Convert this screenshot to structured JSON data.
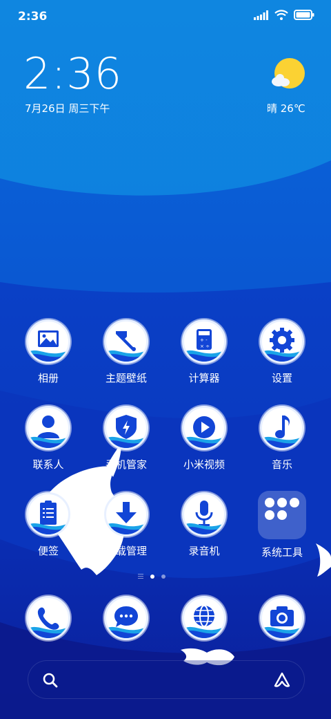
{
  "status_bar": {
    "time": "2:36",
    "icons": [
      "signal-icon",
      "wifi-icon",
      "battery-icon"
    ]
  },
  "clock_widget": {
    "time": "2:36",
    "date": "7月26日 周三下午"
  },
  "weather_widget": {
    "icon": "sunny-cloud-icon",
    "text": "晴 26℃"
  },
  "apps": [
    {
      "label": "相册",
      "icon": "gallery-icon"
    },
    {
      "label": "主题壁纸",
      "icon": "themes-brush-icon"
    },
    {
      "label": "计算器",
      "icon": "calculator-icon"
    },
    {
      "label": "设置",
      "icon": "settings-gear-icon"
    },
    {
      "label": "联系人",
      "icon": "contacts-person-icon"
    },
    {
      "label": "手机管家",
      "icon": "security-shield-icon"
    },
    {
      "label": "小米视频",
      "icon": "video-play-icon"
    },
    {
      "label": "音乐",
      "icon": "music-note-icon"
    },
    {
      "label": "便签",
      "icon": "notes-clipboard-icon"
    },
    {
      "label": "下载管理",
      "icon": "download-arrow-icon"
    },
    {
      "label": "录音机",
      "icon": "recorder-mic-icon"
    },
    {
      "label": "系统工具",
      "icon": "folder-icon"
    }
  ],
  "dock": [
    {
      "icon": "phone-icon"
    },
    {
      "icon": "messages-icon"
    },
    {
      "icon": "browser-globe-icon"
    },
    {
      "icon": "camera-icon"
    }
  ],
  "page_indicator": {
    "pages": 2,
    "current": 1
  },
  "search_bar": {
    "left_icon": "search-icon",
    "right_icon": "assistant-icon"
  },
  "colors": {
    "sky_top": "#0f86e0",
    "deep_blue": "#0a2fb8",
    "icon_blue": "#1245d6",
    "sun": "#fbd233"
  }
}
